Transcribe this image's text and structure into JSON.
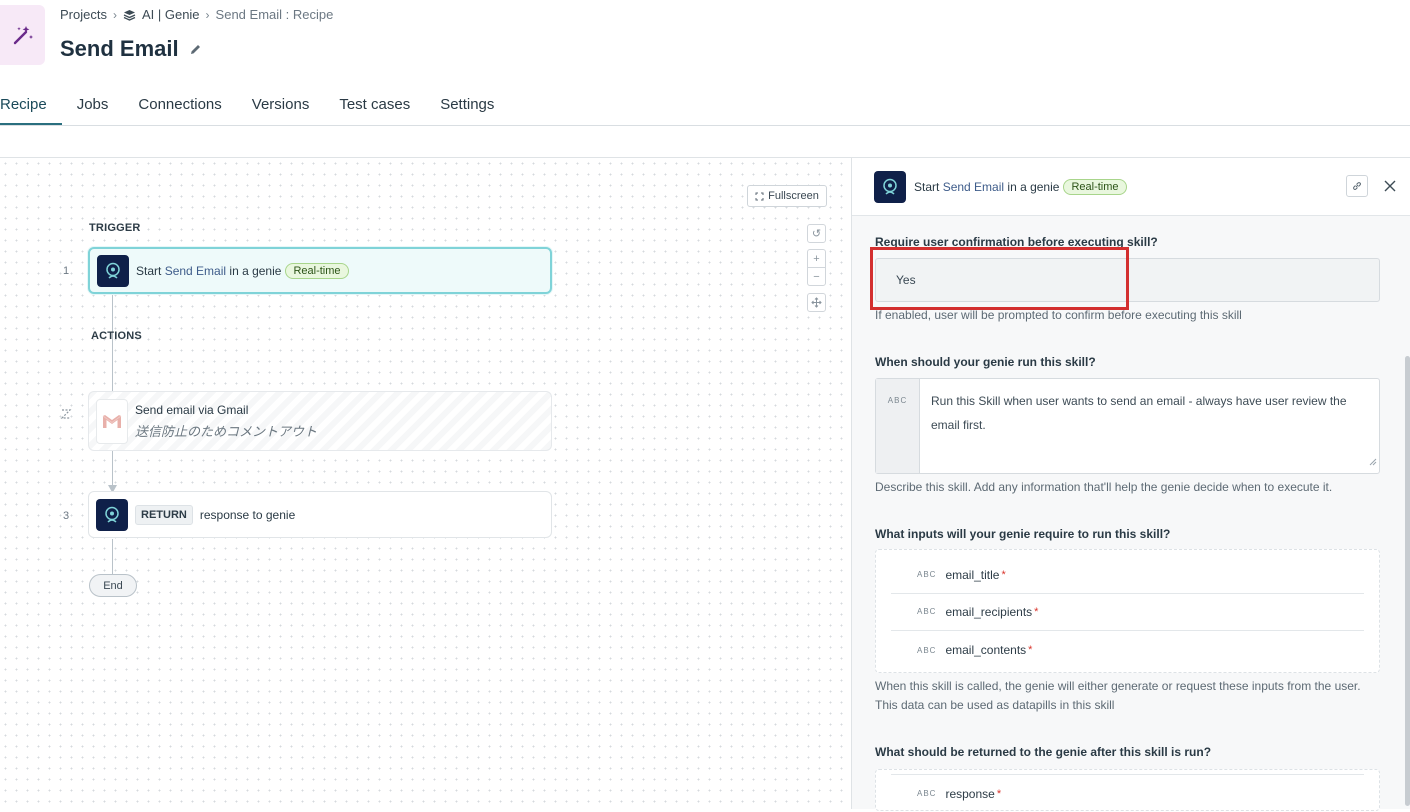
{
  "breadcrumb": {
    "projects": "Projects",
    "folder": "AI | Genie",
    "current": "Send Email : Recipe"
  },
  "page": {
    "title": "Send Email"
  },
  "tabs": [
    "Recipe",
    "Jobs",
    "Connections",
    "Versions",
    "Test cases",
    "Settings"
  ],
  "canvas": {
    "fullscreen_label": "Fullscreen",
    "trigger_label": "TRIGGER",
    "actions_label": "ACTIONS",
    "end_label": "End",
    "steps": [
      {
        "num": "1",
        "prefix": "Start",
        "link": "Send Email",
        "suffix": "in a genie",
        "badge": "Real-time"
      },
      {
        "num": "",
        "title": "Send email via Gmail",
        "note": "送信防止のためコメントアウト"
      },
      {
        "num": "3",
        "return_badge": "RETURN",
        "text": "response to genie"
      }
    ]
  },
  "panel": {
    "header": {
      "prefix": "Start",
      "link": "Send Email",
      "suffix": "in a genie",
      "badge": "Real-time"
    },
    "confirm": {
      "label": "Require user confirmation before executing skill?",
      "value": "Yes",
      "help": "If enabled, user will be prompted to confirm before executing this skill"
    },
    "when": {
      "label": "When should your genie run this skill?",
      "type_tag": "ABC",
      "value": "Run this Skill when user wants to send an email - always have user review the email first.",
      "help": "Describe this skill. Add any information that'll help the genie decide when to execute it."
    },
    "inputs": {
      "label": "What inputs will your genie require to run this skill?",
      "items": [
        {
          "type": "ABC",
          "name": "email_title",
          "required": "*"
        },
        {
          "type": "ABC",
          "name": "email_recipients",
          "required": "*"
        },
        {
          "type": "ABC",
          "name": "email_contents",
          "required": "*"
        }
      ],
      "help": "When this skill is called, the genie will either generate or request these inputs from the user. This data can be used as datapills in this skill"
    },
    "outputs": {
      "label": "What should be returned to the genie after this skill is run?",
      "items": [
        {
          "type": "ABC",
          "name": "response",
          "required": "*"
        }
      ]
    }
  },
  "colors": {
    "accent": "#2a6f7f",
    "highlight": "#d32f2f",
    "genie_icon_bg": "#0f2049",
    "badge_green": "#e9f7de"
  }
}
